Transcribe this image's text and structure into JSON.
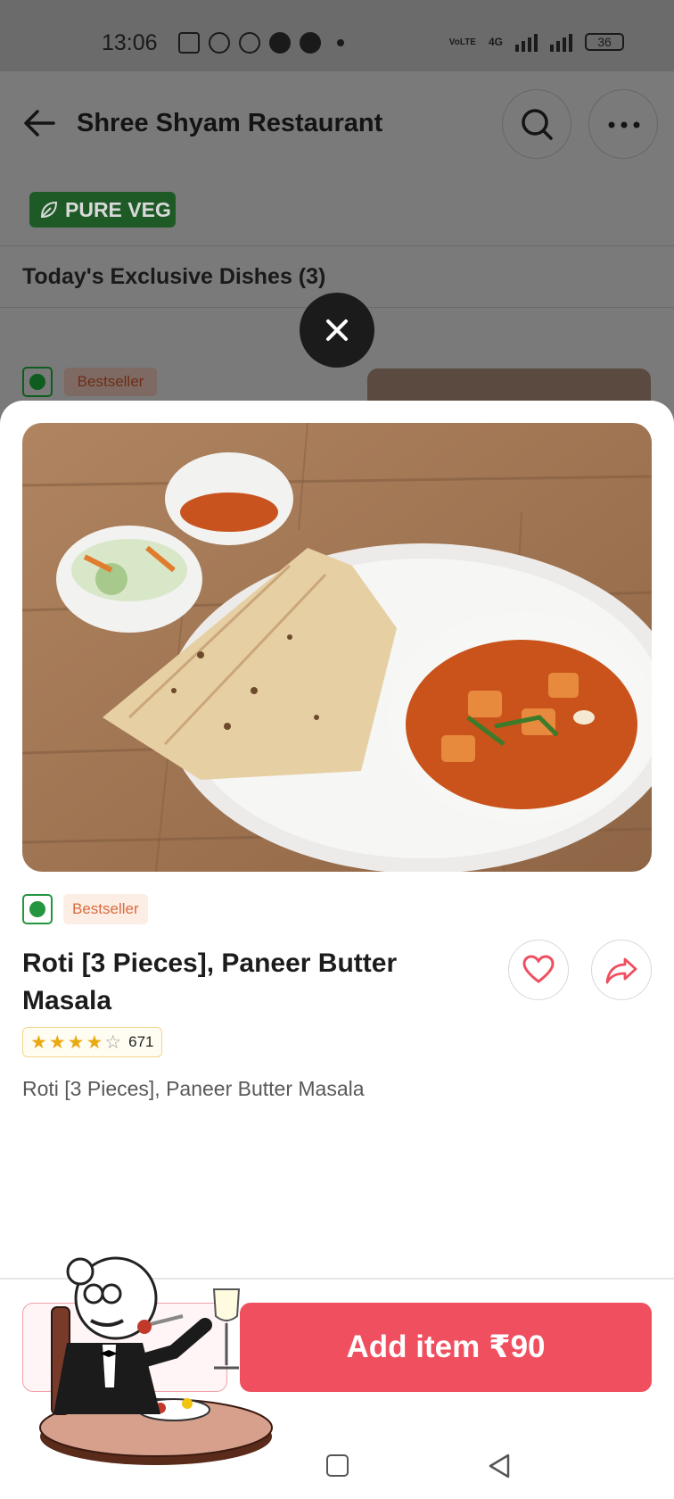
{
  "status_bar": {
    "time": "13:06",
    "network_label": "4G",
    "carrier_label": "VoLTE",
    "battery": "36"
  },
  "header": {
    "back_icon": "arrow-left-icon",
    "restaurant_name": "Shree Shyam Restaurant",
    "search_icon": "search-icon",
    "more_icon": "more-horizontal-icon",
    "veg_badge": "PURE VEG"
  },
  "section": {
    "title": "Today's Exclusive Dishes (3)"
  },
  "background_item": {
    "badge": "Bestseller"
  },
  "modal": {
    "close_icon": "close-icon",
    "badge": "Bestseller",
    "dish_name": "Roti [3 Pieces], Paneer Butter Masala",
    "rating": {
      "stars": 4,
      "max_stars": 5,
      "count": "671"
    },
    "description": "Roti [3 Pieces], Paneer Butter Masala",
    "favorite_icon": "heart-icon",
    "share_icon": "share-icon",
    "add_button_label": "Add item",
    "price": "₹90"
  },
  "colors": {
    "accent": "#ef4f5f",
    "veg_green": "#24963f",
    "bestseller_text": "#d96b3e",
    "star": "#e9a912"
  }
}
